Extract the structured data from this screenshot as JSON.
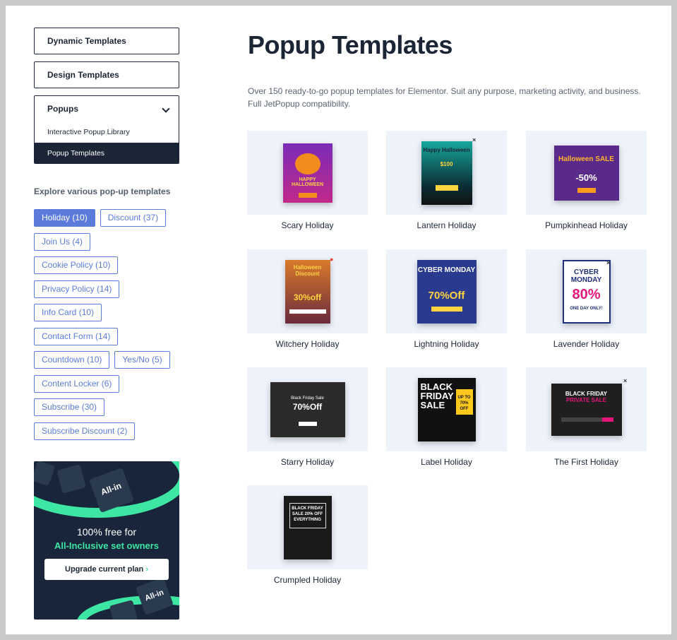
{
  "sidebar": {
    "dynamic_templates": "Dynamic Templates",
    "design_templates": "Design Templates",
    "popups": {
      "label": "Popups",
      "items": [
        {
          "label": "Interactive Popup Library"
        },
        {
          "label": "Popup Templates"
        }
      ]
    },
    "explore_title": "Explore various pop-up templates",
    "tags": [
      {
        "label": "Holiday (10)",
        "active": true
      },
      {
        "label": "Discount (37)"
      },
      {
        "label": "Join Us (4)"
      },
      {
        "label": "Cookie Policy (10)"
      },
      {
        "label": "Privacy Policy (14)"
      },
      {
        "label": "Info Card (10)"
      },
      {
        "label": "Contact Form (14)"
      },
      {
        "label": "Countdown (10)"
      },
      {
        "label": "Yes/No (5)"
      },
      {
        "label": "Content Locker (6)"
      },
      {
        "label": "Subscribe (30)"
      },
      {
        "label": "Subscribe Discount (2)"
      }
    ],
    "promo": {
      "logo_text": "All-in",
      "line1": "100% free for",
      "line2": "All-Inclusive set owners",
      "button": "Upgrade current plan",
      "accent": "#3ee6a3",
      "bg": "#19253a"
    }
  },
  "main": {
    "title": "Popup Templates",
    "description": "Over 150 ready-to-go popup templates for Elementor. Suit any purpose, marketing activity, and business. Full JetPopup compatibility.",
    "templates": [
      {
        "name": "Scary Holiday"
      },
      {
        "name": "Lantern Holiday"
      },
      {
        "name": "Pumpkinhead Holiday"
      },
      {
        "name": "Witchery Holiday"
      },
      {
        "name": "Lightning Holiday"
      },
      {
        "name": "Lavender Holiday"
      },
      {
        "name": "Starry Holiday"
      },
      {
        "name": "Label Holiday"
      },
      {
        "name": "The First Holiday"
      },
      {
        "name": "Crumpled Holiday"
      }
    ],
    "thumb_text": {
      "scary": "HAPPY HALLOWEEN",
      "lantern_1": "Happy Halloween",
      "lantern_2": "$100",
      "pumpkin_1": "Halloween SALE",
      "pumpkin_2": "-50%",
      "witch_1": "Halloween Discount",
      "witch_2": "30%off",
      "cyber1_1": "CYBER MONDAY",
      "cyber1_2": "70%Off",
      "cyber2_1": "CYBER MONDAY",
      "cyber2_2": "80%",
      "cyber2_3": "ONE DAY ONLY!",
      "starry_1": "Black Friday Sale",
      "starry_2": "70%Off",
      "label_1": "BLACK FRIDAY SALE",
      "label_2": "UP TO 70% OFF",
      "first_1": "BLACK FRIDAY",
      "first_2": "PRIVATE SALE",
      "crumple_1": "BLACK FRIDAY SALE 20% OFF EVERYTHING"
    }
  }
}
